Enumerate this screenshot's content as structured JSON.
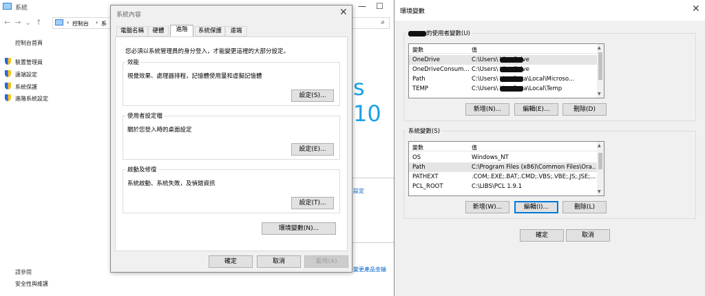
{
  "system_window": {
    "title": "系統",
    "breadcrumb": [
      "控制台",
      "系"
    ],
    "sidebar_home": "控制台首頁",
    "sidebar_links": [
      "裝置管理員",
      "遠端設定",
      "系統保護",
      "進階系統設定"
    ],
    "see_also": "請參閱",
    "security": "安全性與維護",
    "brand_text": "s 10",
    "partial_link_1": "設定",
    "partial_link_2": "變更產品金鑰"
  },
  "props": {
    "title": "系統內容",
    "tabs": [
      "電腦名稱",
      "硬體",
      "進階",
      "系統保護",
      "遠端"
    ],
    "active_tab": "進階",
    "admin_notice": "您必須以系統管理員的身分登入，才能變更這裡的大部分設定。",
    "performance": {
      "legend": "效能",
      "desc": "視覺效果、處理器排程，記憶體使用量和虛擬記憶體",
      "button": "設定(S)..."
    },
    "user_profiles": {
      "legend": "使用者設定檔",
      "desc": "關於您登入時的桌面設定",
      "button": "設定(E)..."
    },
    "startup": {
      "legend": "啟動及修復",
      "desc": "系統啟動、系統失敗，及偵錯資訊",
      "button": "設定(T)..."
    },
    "env_button": "環境變數(N)...",
    "ok": "確定",
    "cancel": "取消",
    "apply": "套用(A)"
  },
  "env": {
    "title": "環境變數",
    "user_section": "的使用者變數(U)",
    "sys_section": "系統變數(S)",
    "col_var": "變數",
    "col_val": "值",
    "user_vars": [
      {
        "name": "OneDrive",
        "value": "C:\\Users\\        \\OneDrive"
      },
      {
        "name": "OneDriveConsum...",
        "value": "C:\\Users\\        \\OneDrive"
      },
      {
        "name": "Path",
        "value": "C:\\Users\\        \\AppData\\Local\\Microso..."
      },
      {
        "name": "TEMP",
        "value": "C:\\Users\\        \\AppData\\Local\\Temp"
      }
    ],
    "sys_vars": [
      {
        "name": "OS",
        "value": "Windows_NT"
      },
      {
        "name": "Path",
        "value": "C:\\Program Files (x86)\\Common Files\\Ora..."
      },
      {
        "name": "PATHEXT",
        "value": ".COM;.EXE;.BAT;.CMD;.VBS;.VBE;.JS;.JSE;..."
      },
      {
        "name": "PCL_ROOT",
        "value": "C:\\LIBS\\PCL 1.9.1"
      }
    ],
    "user_buttons": [
      "新增(N)...",
      "編輯(E)...",
      "刪除(D)"
    ],
    "sys_buttons": [
      "新增(W)...",
      "編輯(I)...",
      "刪除(L)"
    ],
    "ok": "確定",
    "cancel": "取消"
  }
}
